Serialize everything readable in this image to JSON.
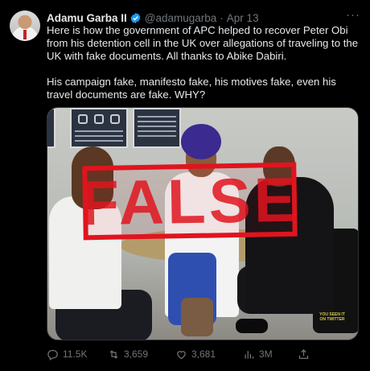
{
  "tweet": {
    "author_name": "Adamu Garba II",
    "handle": "@adamugarba",
    "separator": "·",
    "date": "Apr 13",
    "more_label": "···",
    "paragraph1": "Here is how the government of APC helped to recover Peter Obi from his detention cell in the UK over allegations of traveling to the UK with fake documents. All thanks to Abike Dabiri.",
    "paragraph2": "His campaign fake, manifesto fake, his motives fake, even his travel documents are fake. WHY?"
  },
  "media": {
    "stamp_label": "FALSE",
    "watermark": "YOU SEEN IT ON TWITTER"
  },
  "actions": {
    "reply_count": "11.5K",
    "retweet_count": "3,659",
    "like_count": "3,681",
    "views_count": "3M"
  },
  "colors": {
    "verified": "#1d9bf0",
    "stamp": "#e0141e",
    "secondary_text": "#71767b"
  },
  "icons": [
    "verified-badge-icon",
    "more-icon",
    "reply-icon",
    "retweet-icon",
    "like-icon",
    "views-icon",
    "share-icon"
  ]
}
